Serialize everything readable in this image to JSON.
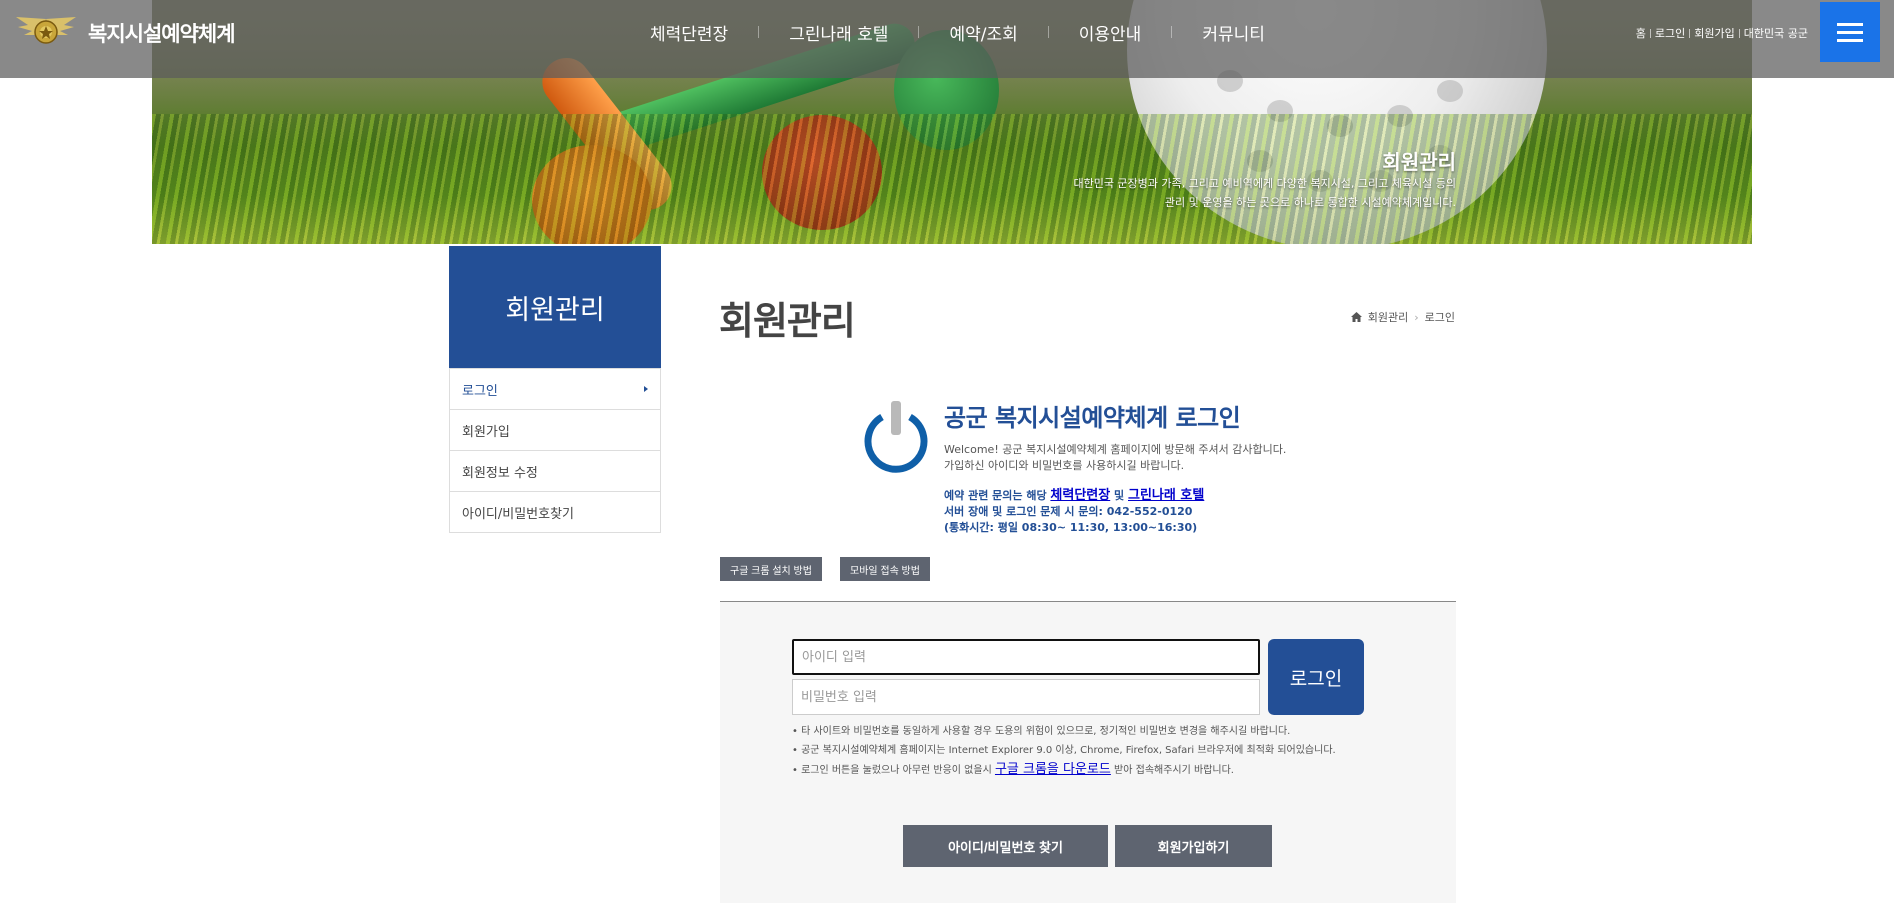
{
  "header": {
    "logo_text": "복지시설예약체계",
    "nav": [
      "체력단련장",
      "그린나래 호텔",
      "예약/조회",
      "이용안내",
      "커뮤니티"
    ],
    "util": [
      "홈",
      "로그인",
      "회원가입",
      "대한민국 공군"
    ],
    "menu_icon": "hamburger-icon"
  },
  "banner": {
    "title": "회원관리",
    "desc_line1": "대한민국 군장병과 가족, 그리고 예비역에게 다양한 복지시설, 그리고 체육시설 등의",
    "desc_line2": "관리 및 운영을 하는 곳으로 하나로 통합한 시설예약체계입니다."
  },
  "sidebar": {
    "title": "회원관리",
    "items": [
      {
        "label": "로그인",
        "active": true
      },
      {
        "label": "회원가입"
      },
      {
        "label": "회원정보 수정"
      },
      {
        "label": "아이디/비밀번호찾기"
      }
    ]
  },
  "main": {
    "page_title": "회원관리",
    "breadcrumb": [
      "회원관리",
      "로그인"
    ],
    "login_title": "공군 복지시설예약체계 로그인",
    "welcome1": "Welcome! 공군 복지시설예약체계 홈페이지에 방문해 주셔서 감사합니다.",
    "welcome2": "가입하신 아이디와 비밀번호를 사용하시길 바랍니다.",
    "contact_prefix": "예약 관련 문의는 해당 ",
    "contact_link1": "체력단련장",
    "contact_mid": " 및 ",
    "contact_link2": "그린나래 호텔",
    "contact_line2": "서버 장애 및 로그인 문제 시 문의: 042-552-0120",
    "contact_line3": "(통화시간: 평일 08:30~ 11:30, 13:00~16:30)",
    "chrome_btn": "구글 크롬 설치 방법",
    "mobile_btn": "모바일 접속 방법",
    "id_placeholder": "아이디 입력",
    "pw_placeholder": "비밀번호 입력",
    "login_btn": "로그인",
    "notice1": "• 타 사이트와 비밀번호를 동일하게 사용할 경우 도용의 위험이 있으므로, 정기적인 비밀번호 변경을 해주시길 바랍니다.",
    "notice2": "• 공군 복지시설예약체계 홈페이지는 Internet Explorer 9.0 이상, Chrome, Firefox, Safari 브라우저에 최적화 되어있습니다.",
    "notice3_prefix": "• 로그인 버튼을 눌렀으나 아무런 반응이 없을시 ",
    "notice3_link": "구글 크롬을 다운로드",
    "notice3_suffix": " 받아 접속해주시기 바랍니다.",
    "find_btn": "아이디/비밀번호 찾기",
    "join_btn": "회원가입하기"
  },
  "colors": {
    "primary": "#234f96",
    "accent": "#1a73e8",
    "button_gray": "#5e6470"
  }
}
